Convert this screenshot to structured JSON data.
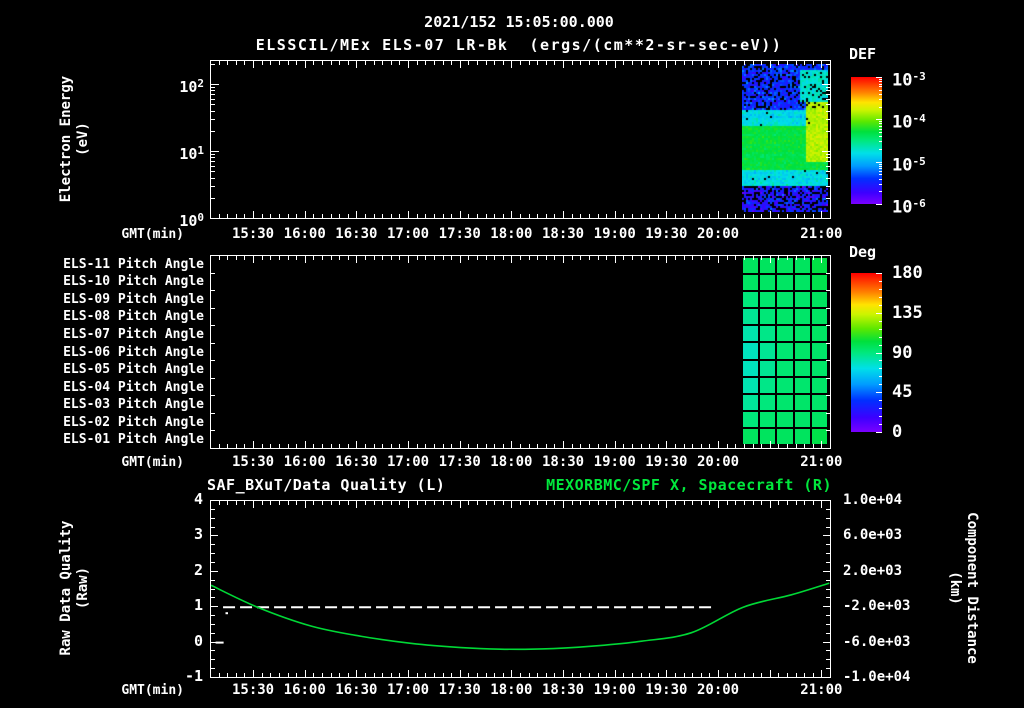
{
  "title": {
    "line1": "2021/152 15:05:00.000",
    "line2": "ELSSCIL/MEx ELS-07 LR-Bk  (ergs/(cm**2-sr-sec-eV))"
  },
  "colors": {
    "background": "#000000",
    "foreground": "#ffffff",
    "curve_green": "#00d836",
    "title_green": "#00e83c"
  },
  "colormap_stops": [
    [
      0,
      "#7a00ff"
    ],
    [
      0.09,
      "#3c00ff"
    ],
    [
      0.2,
      "#0030ff"
    ],
    [
      0.3,
      "#009cff"
    ],
    [
      0.4,
      "#00e0e8"
    ],
    [
      0.5,
      "#00e87c"
    ],
    [
      0.57,
      "#00e03c"
    ],
    [
      0.65,
      "#5ce800"
    ],
    [
      0.74,
      "#ccf400"
    ],
    [
      0.8,
      "#ffe400"
    ],
    [
      0.88,
      "#ff8000"
    ],
    [
      1,
      "#ff0000"
    ]
  ],
  "time_axis": {
    "label": "GMT(min)",
    "start_gmt": "15:05",
    "end_gmt": "21:05",
    "duration_min": 360,
    "major_tick_min": 30,
    "minor_tick_min": 5,
    "tick_labels": [
      {
        "t": 25,
        "text": "15:30"
      },
      {
        "t": 55,
        "text": "16:00"
      },
      {
        "t": 85,
        "text": "16:30"
      },
      {
        "t": 115,
        "text": "17:00"
      },
      {
        "t": 145,
        "text": "17:30"
      },
      {
        "t": 175,
        "text": "18:00"
      },
      {
        "t": 205,
        "text": "18:30"
      },
      {
        "t": 235,
        "text": "19:00"
      },
      {
        "t": 265,
        "text": "19:30"
      },
      {
        "t": 295,
        "text": "20:00"
      },
      {
        "t": 355,
        "text": "21:00"
      }
    ]
  },
  "panels": {
    "spectrogram": {
      "ylabel_line1": "Electron Energy",
      "ylabel_line2": "(eV)",
      "y_tick_exponents": [
        "2",
        "1",
        "0"
      ],
      "colorbar": {
        "title": "DEF",
        "tick_exponents": [
          "-3",
          "-4",
          "-5",
          "-6"
        ]
      }
    },
    "pitch": {
      "row_labels": [
        "ELS-11 Pitch Angle",
        "ELS-10 Pitch Angle",
        "ELS-09 Pitch Angle",
        "ELS-08 Pitch Angle",
        "ELS-07 Pitch Angle",
        "ELS-06 Pitch Angle",
        "ELS-05 Pitch Angle",
        "ELS-04 Pitch Angle",
        "ELS-03 Pitch Angle",
        "ELS-02 Pitch Angle",
        "ELS-01 Pitch Angle"
      ],
      "colorbar": {
        "title": "Deg",
        "tick_labels": [
          "180",
          "135",
          "90",
          "45",
          "0"
        ]
      }
    },
    "quality": {
      "title_left": "SAF_BXuT/Data Quality (L)",
      "title_right": "MEXORBMC/SPF X, Spacecraft (R)",
      "ylabel_left_line1": "Raw Data Quality",
      "ylabel_left_line2": "(Raw)",
      "ylabel_right_line1": "Component Distance",
      "ylabel_right_line2": "(km)",
      "y_left_tick_labels": [
        "4",
        "3",
        "2",
        "1",
        "0",
        "-1"
      ],
      "y_right_tick_labels": [
        "1.0e+04",
        "6.0e+03",
        "2.0e+03",
        "-2.0e+03",
        "-6.0e+03",
        "-1.0e+04"
      ]
    }
  },
  "chart_data": [
    {
      "id": "electron-energy-spectrogram",
      "type": "heatmap",
      "title": "ELSSCIL/MEx ELS-07 LR-Bk",
      "units": "ergs/(cm**2-sr-sec-eV)",
      "x_axis": {
        "label": "GMT(min)",
        "range_gmt": [
          "15:05",
          "21:05"
        ]
      },
      "y_axis": {
        "label": "Electron Energy (eV)",
        "scale": "log",
        "range_ev": [
          1,
          230
        ]
      },
      "color_axis": {
        "label": "DEF",
        "scale": "log",
        "range": [
          1e-06,
          0.001
        ]
      },
      "coverage": {
        "t0_min": 309,
        "t1_min": 359,
        "t0_gmt": "20:14",
        "t1_gmt": "21:04"
      },
      "bands": [
        {
          "e_min": 1.0,
          "e_max": 3.2,
          "log_flux": -5.95,
          "noise": 0.5,
          "black_frac": 0.3
        },
        {
          "e_min": 3.2,
          "e_max": 5.5,
          "log_flux": -5.05,
          "noise": 0.3,
          "black_frac": 0.02
        },
        {
          "e_min": 5.5,
          "e_max": 24,
          "log_flux": -4.5,
          "noise": 0.2,
          "black_frac": 0
        },
        {
          "e_min": 24,
          "e_max": 42,
          "log_flux": -5.1,
          "noise": 0.28,
          "black_frac": 0.02
        },
        {
          "e_min": 42,
          "e_max": 250,
          "log_flux": -5.8,
          "noise": 0.42,
          "black_frac": 0.2
        }
      ],
      "features": [
        {
          "label": "bright-blob",
          "t0": 346,
          "t1": 358,
          "e_min": 7,
          "e_max": 55,
          "log_flux": -3.95,
          "noise": 0.2
        },
        {
          "label": "upper-enhancement",
          "t0": 342,
          "t1": 359,
          "e_min": 55,
          "e_max": 170,
          "log_flux": -5.0,
          "noise": 0.3
        }
      ]
    },
    {
      "id": "pitch-angle-grid",
      "type": "heatmap",
      "rows": [
        "ELS-11",
        "ELS-10",
        "ELS-09",
        "ELS-08",
        "ELS-07",
        "ELS-06",
        "ELS-05",
        "ELS-04",
        "ELS-03",
        "ELS-02",
        "ELS-01"
      ],
      "columns": 5,
      "coverage": {
        "t0_min": 309,
        "t1_min": 359,
        "t0_gmt": "20:14",
        "t1_gmt": "21:04"
      },
      "color_axis": {
        "label": "Deg",
        "range": [
          0,
          180
        ]
      },
      "values_deg": [
        [
          96,
          96,
          96,
          96,
          101
        ],
        [
          95,
          95,
          95,
          95,
          99
        ],
        [
          90,
          93,
          94,
          94,
          96
        ],
        [
          86,
          91,
          94,
          94,
          95
        ],
        [
          82,
          88,
          93,
          94,
          95
        ],
        [
          79,
          86,
          92,
          94,
          94
        ],
        [
          79,
          86,
          92,
          93,
          94
        ],
        [
          81,
          88,
          92,
          93,
          94
        ],
        [
          85,
          90,
          93,
          94,
          94
        ],
        [
          90,
          93,
          94,
          94,
          95
        ],
        [
          96,
          96,
          96,
          96,
          100
        ]
      ]
    },
    {
      "id": "quality-and-distance",
      "type": "line",
      "x_axis": {
        "label": "GMT(min)",
        "range_gmt": [
          "15:05",
          "21:05"
        ],
        "duration_min": 360
      },
      "left_axis": {
        "label": "Raw Data Quality (Raw)",
        "range": [
          -1,
          4
        ]
      },
      "right_axis": {
        "label": "Component Distance (km)",
        "range": [
          -10000,
          10000
        ]
      },
      "series": [
        {
          "name": "SAF_BXuT/Data Quality",
          "axis": "left",
          "style": "dashed",
          "color": "#ffffff",
          "points": [
            [
              7,
              1
            ],
            [
              292,
              1
            ]
          ]
        },
        {
          "name": "MEXORBMC/SPF X, Spacecraft",
          "axis": "right",
          "style": "solid",
          "color": "#00d836",
          "points": [
            [
              0,
              480
            ],
            [
              27,
              -2000
            ],
            [
              58,
              -4120
            ],
            [
              87,
              -5280
            ],
            [
              116,
              -6080
            ],
            [
              145,
              -6560
            ],
            [
              168,
              -6740
            ],
            [
              192,
              -6720
            ],
            [
              221,
              -6400
            ],
            [
              250,
              -5840
            ],
            [
              279,
              -4880
            ],
            [
              309,
              -2000
            ],
            [
              337,
              -600
            ],
            [
              359,
              720
            ]
          ]
        }
      ],
      "point_markers": [
        {
          "t": 9,
          "value": 0.83,
          "axis": "left",
          "shape": "dot"
        },
        {
          "t": 5,
          "value": 0.0,
          "axis": "left",
          "shape": "dash"
        }
      ]
    }
  ]
}
